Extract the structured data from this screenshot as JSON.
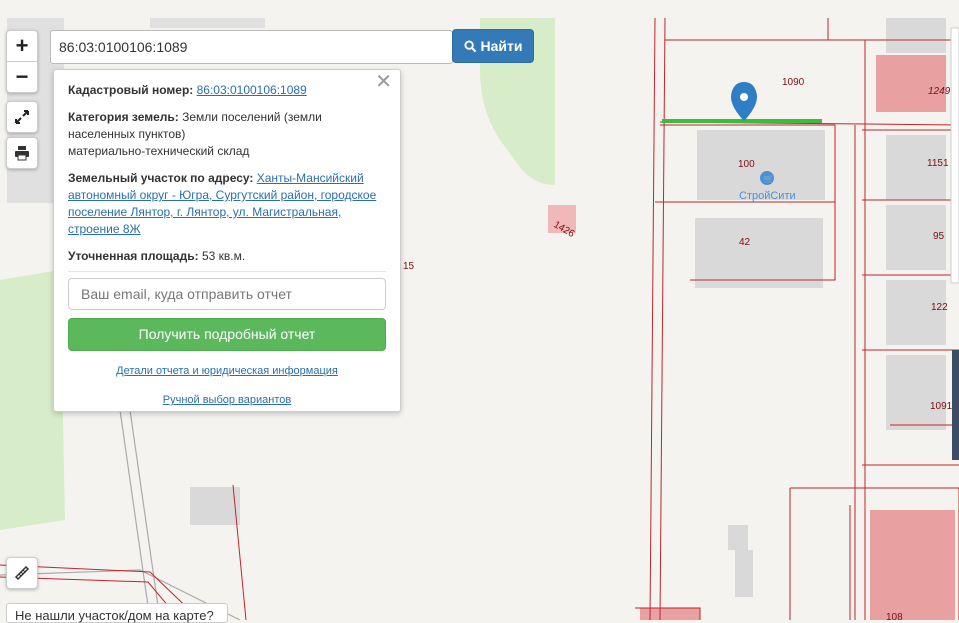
{
  "search": {
    "value": "86:03:0100106:1089",
    "button_label": "Найти"
  },
  "zoom": {
    "in_label": "+",
    "out_label": "−"
  },
  "popup": {
    "cadastral_label": "Кадастровый номер:",
    "cadastral_value": "86:03:0100106:1089",
    "category_label": "Категория земель:",
    "category_value": "Земли поселений (земли населенных пунктов)",
    "category_use": "материально-технический склад",
    "address_label": "Земельный участок по адресу:",
    "address_value": "Ханты-Мансийский автономный округ - Югра, Сургутский район, городское поселение Лянтор, г. Лянтор, ул. Магистральная, строение 8Ж",
    "area_label": "Уточненная площадь:",
    "area_value": "53 кв.м.",
    "email_placeholder": "Ваш email, куда отправить отчет",
    "report_button": "Получить подробный отчет",
    "details_link": "Детали отчета и юридическая информация",
    "manual_link": "Ручной выбор вариантов"
  },
  "bottom_link": "Не нашли участок/дом на карте?",
  "map_labels": {
    "l1090": "1090",
    "l1249": "1249",
    "l100": "100",
    "shop": "СтройСити",
    "l1151": "1151",
    "l1426": "1426",
    "l42": "42",
    "l95": "95",
    "l15": "15",
    "l122": "122",
    "l1091": "1091",
    "l108": "108"
  },
  "colors": {
    "parcel_border": "#c0262b",
    "highlight": "#3dbb3d",
    "building": "#d9d9d9",
    "green_area": "#d7ecc9",
    "primary": "#337ab7",
    "success": "#5cb85c"
  }
}
